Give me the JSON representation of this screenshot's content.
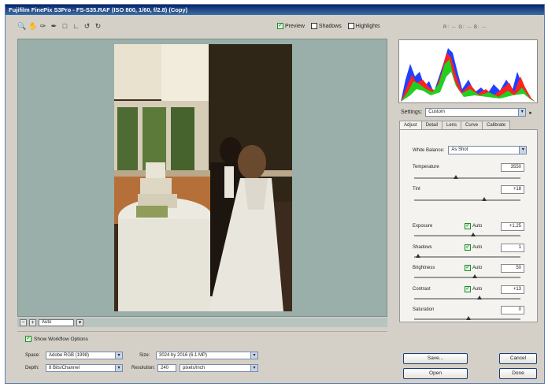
{
  "window": {
    "title": "Fujifilm FinePix S3Pro - FS-S35.RAF (ISO 800, 1/60, f/2.8)  (Copy)"
  },
  "toolbar": {
    "tools": [
      "zoom-icon",
      "hand-icon",
      "eyedropper-icon",
      "color-sampler-icon",
      "crop-icon",
      "straighten-icon",
      "rotate-left-icon",
      "rotate-right-icon"
    ]
  },
  "view_options": {
    "preview_label": "Preview",
    "preview_checked": true,
    "shadows_label": "Shadows",
    "shadows_checked": false,
    "highlights_label": "Highlights",
    "highlights_checked": false
  },
  "rgb_readout": "R: --  G: --  B: --",
  "zoom": {
    "value": "Auto"
  },
  "settings": {
    "label": "Settings:",
    "value": "Custom"
  },
  "tabs": [
    "Adjust",
    "Detail",
    "Lens",
    "Curve",
    "Calibrate"
  ],
  "adjust": {
    "white_balance_label": "White Balance:",
    "white_balance_value": "As Shot",
    "temperature_label": "Temperature",
    "temperature_value": "3550",
    "tint_label": "Tint",
    "tint_value": "+18",
    "exposure_label": "Exposure",
    "exposure_value": "+1.25",
    "shadows_label": "Shadows",
    "shadows_value": "1",
    "brightness_label": "Brightness",
    "brightness_value": "50",
    "contrast_label": "Contrast",
    "contrast_value": "+13",
    "saturation_label": "Saturation",
    "saturation_value": "0",
    "auto_label": "Auto"
  },
  "workflow": {
    "show_label": "Show Workflow Options",
    "space_label": "Space:",
    "space_value": "Adobe RGB (1998)",
    "size_label": "Size:",
    "size_value": "3024 by 2016 (6.1 MP)",
    "depth_label": "Depth:",
    "depth_value": "8 Bits/Channel",
    "resolution_label": "Resolution:",
    "resolution_value": "240",
    "resolution_unit": "pixels/inch"
  },
  "buttons": {
    "save": "Save...",
    "open": "Open",
    "cancel": "Cancel",
    "done": "Done"
  },
  "colors": {
    "title_start": "#0a246a",
    "title_end": "#3a6ea5",
    "preview_bg": "#9aaeaa",
    "accent_green": "#1e8a2a"
  }
}
